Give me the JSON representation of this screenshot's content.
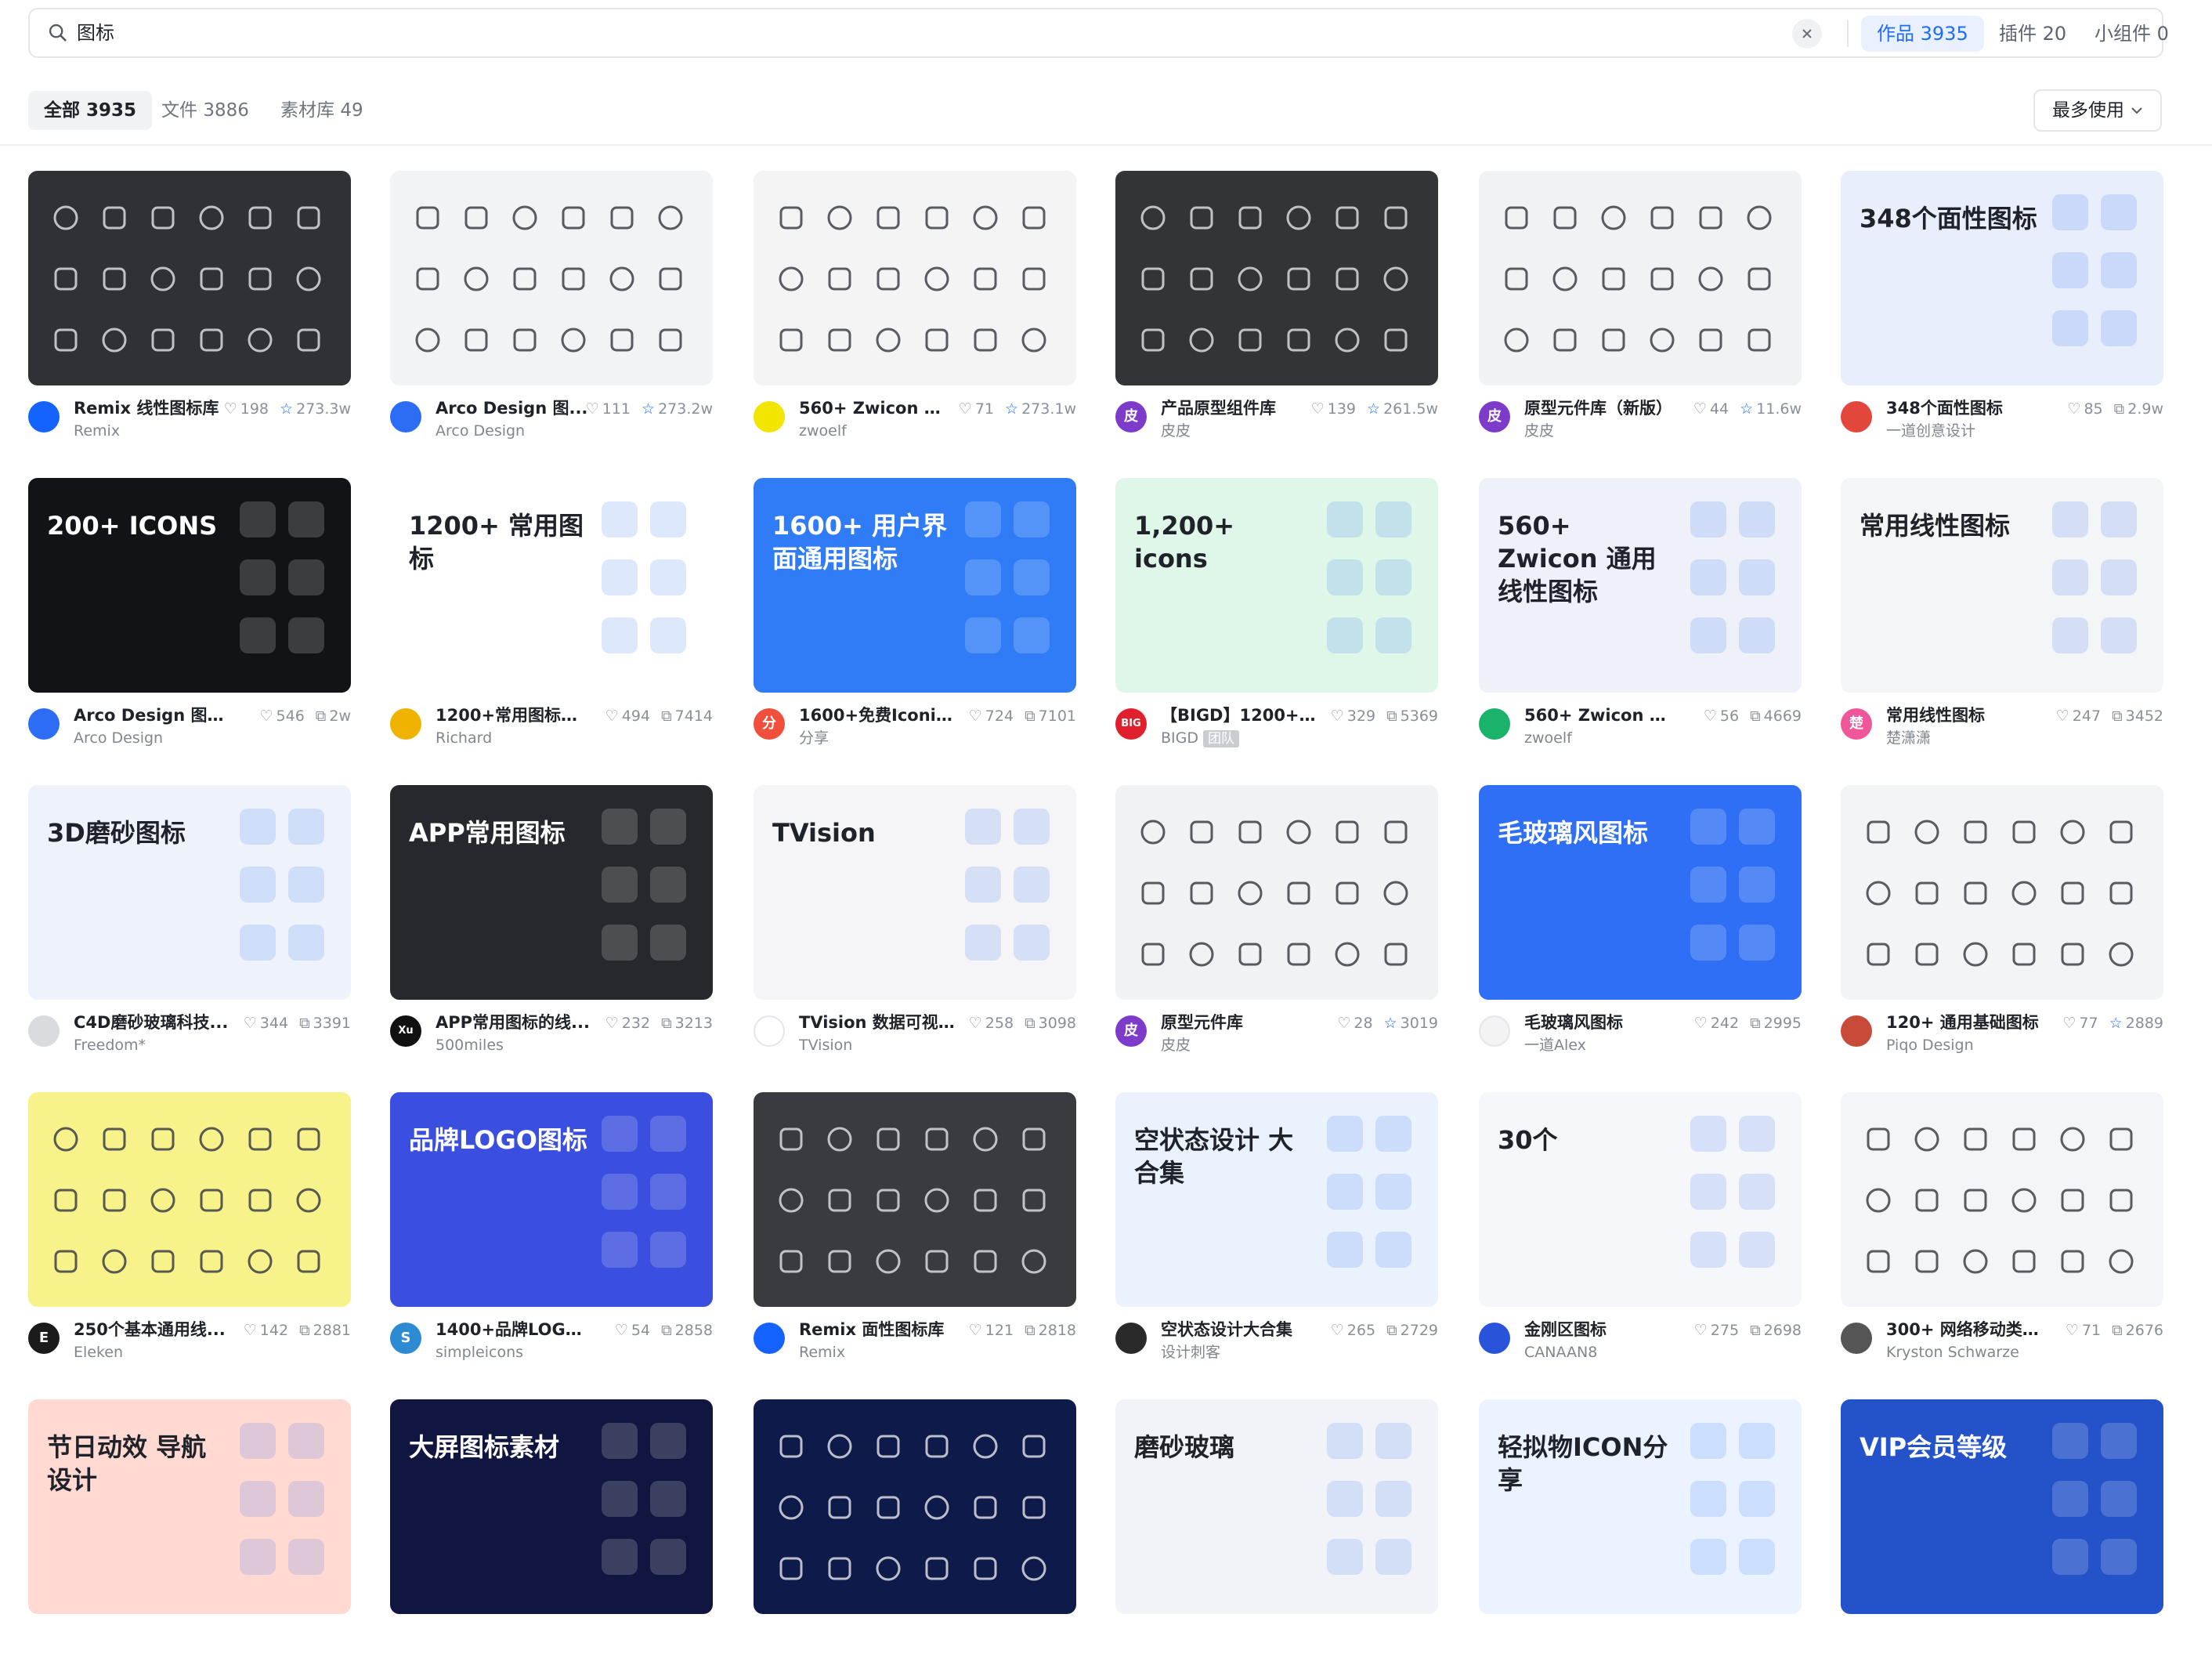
{
  "search": {
    "query": "图标"
  },
  "scopes": [
    {
      "label": "作品",
      "count": "3935",
      "active": true
    },
    {
      "label": "插件",
      "count": "20",
      "active": false
    },
    {
      "label": "小组件",
      "count": "0",
      "active": false
    }
  ],
  "filters": [
    {
      "label": "全部",
      "count": "3935",
      "active": true
    },
    {
      "label": "文件",
      "count": "3886",
      "active": false
    },
    {
      "label": "素材库",
      "count": "49",
      "active": false
    }
  ],
  "sort": {
    "label": "最多使用"
  },
  "colors": {
    "accent": "#1f6bff",
    "accent_bg": "#e9f1ff"
  },
  "cards": [
    {
      "title": "Remix 线性图标库",
      "author": "Remix",
      "likes": "198",
      "stat2": "273.3w",
      "stat2_icon": "star",
      "avatar_color": "#1463ff",
      "avatar_text": "",
      "thumb": "#2f3136",
      "thumb_text": ""
    },
    {
      "title": "Arco Design 图...",
      "author": "Arco Design",
      "likes": "111",
      "stat2": "273.2w",
      "stat2_icon": "star",
      "avatar_color": "#2d6df6",
      "avatar_text": "",
      "thumb": "#f2f3f5",
      "thumb_text": ""
    },
    {
      "title": "560+ Zwicon 通...",
      "author": "zwoelf",
      "likes": "71",
      "stat2": "273.1w",
      "stat2_icon": "star",
      "avatar_color": "#f2e600",
      "avatar_text": "",
      "thumb": "#f4f4f5",
      "thumb_text": ""
    },
    {
      "title": "产品原型组件库",
      "author": "皮皮",
      "likes": "139",
      "stat2": "261.5w",
      "stat2_icon": "star",
      "avatar_color": "#7c3cc9",
      "avatar_text": "皮",
      "thumb": "#333438",
      "thumb_text": ""
    },
    {
      "title": "原型元件库（新版）",
      "author": "皮皮",
      "likes": "44",
      "stat2": "11.6w",
      "stat2_icon": "star",
      "avatar_color": "#7c3cc9",
      "avatar_text": "皮",
      "thumb": "#f1f2f3",
      "thumb_text": ""
    },
    {
      "title": "348个面性图标",
      "author": "一道创意设计",
      "likes": "85",
      "stat2": "2.9w",
      "stat2_icon": "copy",
      "avatar_color": "#e3463a",
      "avatar_text": "",
      "thumb": "#e8eefb",
      "thumb_text": "348个面性图标"
    },
    {
      "title": "Arco Design 图标库",
      "author": "Arco Design",
      "likes": "546",
      "stat2": "2w",
      "stat2_icon": "copy",
      "avatar_color": "#2d6df6",
      "avatar_text": "",
      "thumb": "#121316",
      "thumb_text": "200+ ICONS"
    },
    {
      "title": "1200+常用图标集 ...",
      "author": "Richard",
      "likes": "494",
      "stat2": "7414",
      "stat2_icon": "copy",
      "avatar_color": "#f0b400",
      "avatar_text": "",
      "thumb": "#ffffff",
      "thumb_text": "1200+ 常用图标"
    },
    {
      "title": "1600+免费Iconia...",
      "author": "分享",
      "likes": "724",
      "stat2": "7101",
      "stat2_icon": "copy",
      "avatar_color": "#f04f3c",
      "avatar_text": "分",
      "thumb": "#2f7cf6",
      "thumb_text": "1600+ 用户界面通用图标"
    },
    {
      "title": "【BIGD】1200+免...",
      "author": "BIGD",
      "likes": "329",
      "stat2": "5369",
      "stat2_icon": "copy",
      "avatar_color": "#e0202d",
      "avatar_text": "BIG",
      "thumb": "#dff7e9",
      "thumb_text": "1,200+ icons"
    },
    {
      "title": "560+ Zwicon 通用...",
      "author": "zwoelf",
      "likes": "56",
      "stat2": "4669",
      "stat2_icon": "copy",
      "avatar_color": "#1bb26b",
      "avatar_text": "",
      "thumb": "#eef1f8",
      "thumb_text": "560+ Zwicon 通用线性图标"
    },
    {
      "title": "常用线性图标",
      "author": "楚潇潇",
      "likes": "247",
      "stat2": "3452",
      "stat2_icon": "copy",
      "avatar_color": "#f0569a",
      "avatar_text": "楚",
      "thumb": "#f4f5f7",
      "thumb_text": "常用线性图标"
    },
    {
      "title": "C4D磨砂玻璃科技...",
      "author": "Freedom*",
      "likes": "344",
      "stat2": "3391",
      "stat2_icon": "copy",
      "avatar_color": "#d9dbde",
      "avatar_text": "",
      "thumb": "#eef3fb",
      "thumb_text": "3D磨砂图标"
    },
    {
      "title": "APP常用图标的线...",
      "author": "500miles",
      "likes": "232",
      "stat2": "3213",
      "stat2_icon": "copy",
      "avatar_color": "#111111",
      "avatar_text": "Xu",
      "thumb": "#26282d",
      "thumb_text": "APP常用图标"
    },
    {
      "title": "TVision 数据可视...",
      "author": "TVision",
      "likes": "258",
      "stat2": "3098",
      "stat2_icon": "copy",
      "avatar_color": "#ffffff",
      "avatar_text": "",
      "thumb": "#f5f5f7",
      "thumb_text": "TVision"
    },
    {
      "title": "原型元件库",
      "author": "皮皮",
      "likes": "28",
      "stat2": "3019",
      "stat2_icon": "star",
      "avatar_color": "#7c3cc9",
      "avatar_text": "皮",
      "thumb": "#f1f2f3",
      "thumb_text": ""
    },
    {
      "title": "毛玻璃风图标",
      "author": "一道Alex",
      "likes": "242",
      "stat2": "2995",
      "stat2_icon": "copy",
      "avatar_color": "#f3f3f3",
      "avatar_text": "",
      "thumb": "#2f6ff5",
      "thumb_text": "毛玻璃风图标"
    },
    {
      "title": "120+ 通用基础图标",
      "author": "Piqo Design",
      "likes": "77",
      "stat2": "2889",
      "stat2_icon": "star",
      "avatar_color": "#c84b3a",
      "avatar_text": "",
      "thumb": "#f3f4f6",
      "thumb_text": ""
    },
    {
      "title": "250个基本通用线...",
      "author": "Eleken",
      "likes": "142",
      "stat2": "2881",
      "stat2_icon": "copy",
      "avatar_color": "#1b1b1b",
      "avatar_text": "E",
      "thumb": "#f7f28a",
      "thumb_text": ""
    },
    {
      "title": "1400+品牌LOGO图标",
      "author": "simpleicons",
      "likes": "54",
      "stat2": "2858",
      "stat2_icon": "copy",
      "avatar_color": "#2d8bd4",
      "avatar_text": "S",
      "thumb": "#3a4fe0",
      "thumb_text": "品牌LOGO图标"
    },
    {
      "title": "Remix 面性图标库",
      "author": "Remix",
      "likes": "121",
      "stat2": "2818",
      "stat2_icon": "copy",
      "avatar_color": "#1463ff",
      "avatar_text": "",
      "thumb": "#3a3b40",
      "thumb_text": ""
    },
    {
      "title": "空状态设计大合集",
      "author": "设计刺客",
      "likes": "265",
      "stat2": "2729",
      "stat2_icon": "copy",
      "avatar_color": "#2a2a2a",
      "avatar_text": "",
      "thumb": "#eaf2fd",
      "thumb_text": "空状态设计 大合集"
    },
    {
      "title": "金刚区图标",
      "author": "CANAAN8",
      "likes": "275",
      "stat2": "2698",
      "stat2_icon": "copy",
      "avatar_color": "#2953d8",
      "avatar_text": "",
      "thumb": "#f6f7fb",
      "thumb_text": "30个"
    },
    {
      "title": "300+ 网络移动类基...",
      "author": "Kryston Schwarze",
      "likes": "71",
      "stat2": "2676",
      "stat2_icon": "copy",
      "avatar_color": "#555555",
      "avatar_text": "",
      "thumb": "#f4f5f8",
      "thumb_text": ""
    },
    {
      "title": "",
      "author": "",
      "likes": "",
      "stat2": "",
      "stat2_icon": "",
      "avatar_color": "",
      "avatar_text": "",
      "thumb": "#ffd9d2",
      "thumb_text": "节日动效 导航设计"
    },
    {
      "title": "",
      "author": "",
      "likes": "",
      "stat2": "",
      "stat2_icon": "",
      "avatar_color": "",
      "avatar_text": "",
      "thumb": "#10163f",
      "thumb_text": "大屏图标素材"
    },
    {
      "title": "",
      "author": "",
      "likes": "",
      "stat2": "",
      "stat2_icon": "",
      "avatar_color": "",
      "avatar_text": "",
      "thumb": "#0e1a4a",
      "thumb_text": ""
    },
    {
      "title": "",
      "author": "",
      "likes": "",
      "stat2": "",
      "stat2_icon": "",
      "avatar_color": "",
      "avatar_text": "",
      "thumb": "#f2f3f8",
      "thumb_text": "磨砂玻璃"
    },
    {
      "title": "",
      "author": "",
      "likes": "",
      "stat2": "",
      "stat2_icon": "",
      "avatar_color": "",
      "avatar_text": "",
      "thumb": "#eaf3ff",
      "thumb_text": "轻拟物ICON分享"
    },
    {
      "title": "",
      "author": "",
      "likes": "",
      "stat2": "",
      "stat2_icon": "",
      "avatar_color": "",
      "avatar_text": "",
      "thumb": "#2453c9",
      "thumb_text": "VIP会员等级"
    }
  ]
}
